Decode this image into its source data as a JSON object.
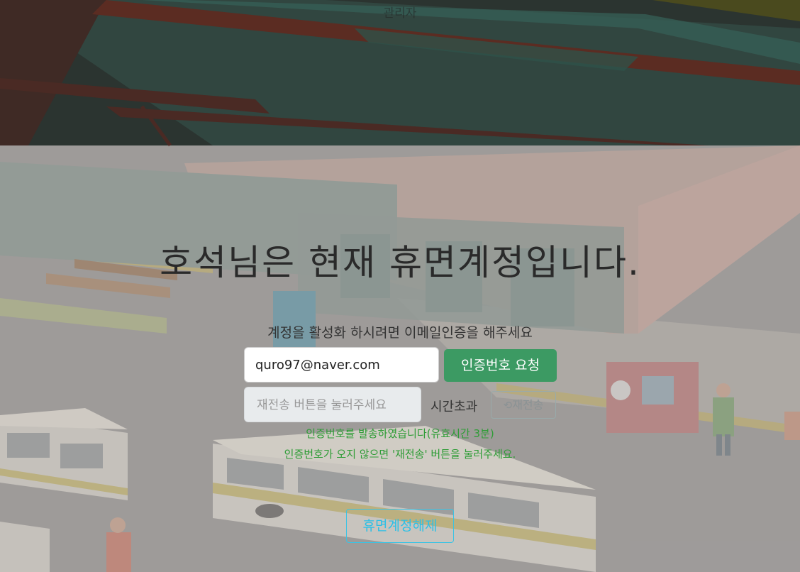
{
  "header": {
    "link_label": "관리자"
  },
  "main": {
    "title": "호석님은 현재 휴면계정입니다.",
    "instruction": "계정을 활성화 하시려면 이메일인증을 해주세요",
    "email_value": "quro97@naver.com",
    "request_button_label": "인증번호 요청",
    "code_placeholder": "재전송 버튼을 눌러주세요",
    "timer_text": "시간초과",
    "resend_button_label": "재전송",
    "message_sent": "인증번호를 발송하였습니다(유효시간 3분)",
    "message_help": "인증번호가 오지 않으면 '재전송' 버튼을 눌러주세요.",
    "release_button_label": "휴면계정해제"
  },
  "icons": {
    "resend": "refresh-icon"
  },
  "colors": {
    "primary_green": "#3c9a63",
    "message_green": "#2d9c35",
    "cyan_accent": "#2cc0e6"
  }
}
